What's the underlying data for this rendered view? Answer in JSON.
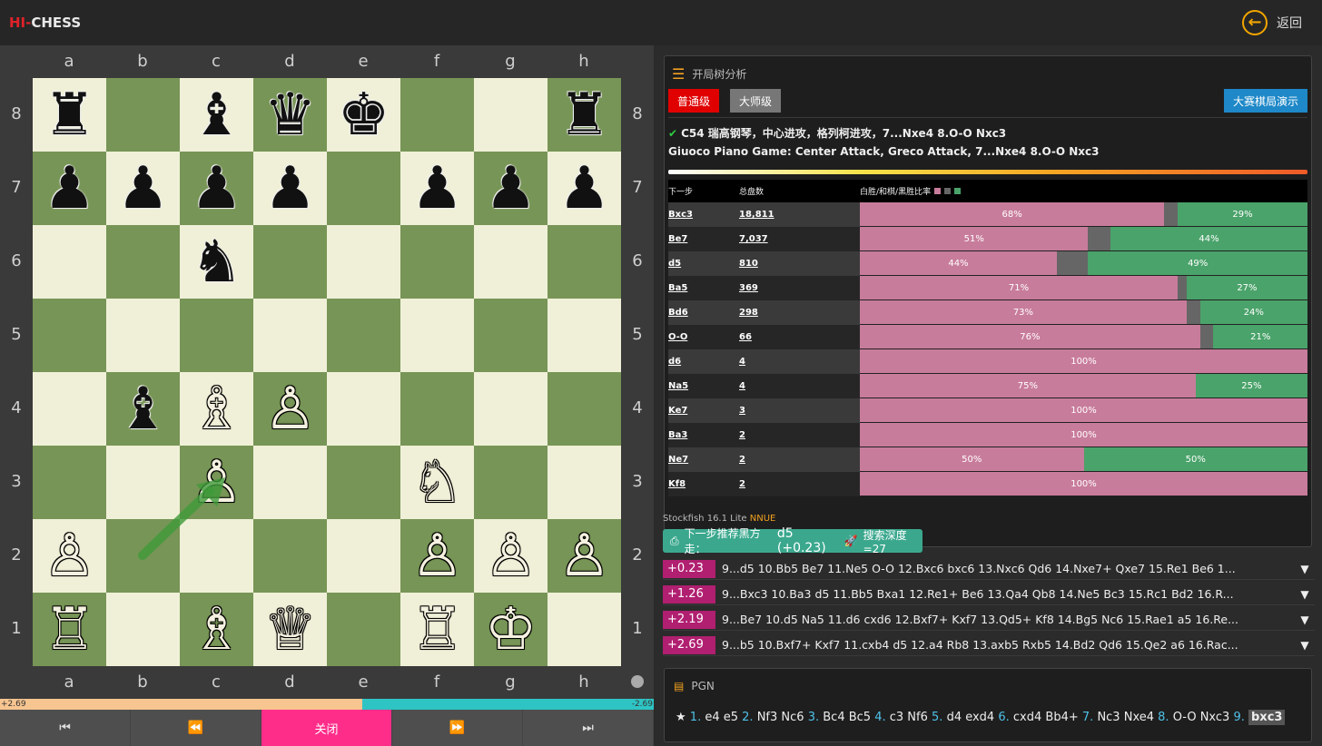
{
  "app": {
    "logo_hi": "HI-",
    "logo_chess": "CHESS",
    "back_label": "返回",
    "back_icon": "arrow-left-circle-icon"
  },
  "board": {
    "files": [
      "a",
      "b",
      "c",
      "d",
      "e",
      "f",
      "g",
      "h"
    ],
    "ranks": [
      "8",
      "7",
      "6",
      "5",
      "4",
      "3",
      "2",
      "1"
    ],
    "position": [
      [
        "♜",
        "",
        "♝",
        "♛",
        "♚",
        "",
        "",
        "♜"
      ],
      [
        "♟",
        "♟",
        "♟",
        "♟",
        "",
        "♟",
        "♟",
        "♟"
      ],
      [
        "",
        "",
        "♞",
        "",
        "",
        "",
        "",
        ""
      ],
      [
        "",
        "",
        "",
        "",
        "",
        "",
        "",
        ""
      ],
      [
        "",
        "♝",
        "♗",
        "♙",
        "",
        "",
        "",
        ""
      ],
      [
        "",
        "",
        "♙",
        "",
        "",
        "♘",
        "",
        ""
      ],
      [
        "♙",
        "",
        "",
        "",
        "",
        "♙",
        "♙",
        "♙"
      ],
      [
        "♖",
        "",
        "♗",
        "♕",
        "",
        "♖",
        "♔",
        ""
      ]
    ],
    "colors": [
      [
        "b",
        "",
        "b",
        "b",
        "b",
        "",
        "",
        "b"
      ],
      [
        "b",
        "b",
        "b",
        "b",
        "",
        "b",
        "b",
        "b"
      ],
      [
        "",
        "",
        "b",
        "",
        "",
        "",
        "",
        ""
      ],
      [
        "",
        "",
        "",
        "",
        "",
        "",
        "",
        ""
      ],
      [
        "",
        "b",
        "w",
        "w",
        "",
        "",
        "",
        ""
      ],
      [
        "",
        "",
        "w",
        "",
        "",
        "w",
        "",
        ""
      ],
      [
        "w",
        "",
        "",
        "",
        "",
        "w",
        "w",
        "w"
      ],
      [
        "w",
        "",
        "w",
        "w",
        "",
        "w",
        "w",
        ""
      ]
    ],
    "arrow": {
      "from": "b2",
      "to": "c3",
      "color": "#3f9a3a"
    }
  },
  "eval_bar": {
    "white_text": "+2.69",
    "black_text": "-2.69",
    "white_fraction": 0.554
  },
  "controls": [
    {
      "name": "first",
      "label": "⏮",
      "icon": "skip-back-icon"
    },
    {
      "name": "prev",
      "label": "⏪",
      "icon": "rewind-icon"
    },
    {
      "name": "close",
      "label": "关闭"
    },
    {
      "name": "next",
      "label": "⏩",
      "icon": "fast-forward-icon"
    },
    {
      "name": "last",
      "label": "⏭",
      "icon": "skip-forward-icon"
    }
  ],
  "opening": {
    "header": "开局树分析",
    "level_normal": "普通级",
    "level_master": "大师级",
    "demo_button": "大赛棋局演示",
    "name_cn": "C54 瑞高钢琴，中心进攻，格列柯进攻，7...Nxe4 8.O-O Nxc3",
    "name_en": "Giuoco Piano Game: Center Attack, Greco Attack, 7...Nxe4 8.O-O Nxc3",
    "col_move": "下一步",
    "col_count": "总盘数",
    "col_ratio": "白胜/和棋/黑胜比率",
    "colors": {
      "white": "#c87c9b",
      "draw": "#666666",
      "black": "#4aa36a"
    },
    "moves": [
      {
        "move": "Bxc3",
        "count": "18,811",
        "w": 68,
        "d": 3,
        "b": 29,
        "wl": "68%",
        "bl": "29%"
      },
      {
        "move": "Be7",
        "count": "7,037",
        "w": 51,
        "d": 5,
        "b": 44,
        "wl": "51%",
        "bl": "44%"
      },
      {
        "move": "d5",
        "count": "810",
        "w": 44,
        "d": 7,
        "b": 49,
        "wl": "44%",
        "bl": "49%"
      },
      {
        "move": "Ba5",
        "count": "369",
        "w": 71,
        "d": 2,
        "b": 27,
        "wl": "71%",
        "bl": "27%"
      },
      {
        "move": "Bd6",
        "count": "298",
        "w": 73,
        "d": 3,
        "b": 24,
        "wl": "73%",
        "bl": "24%"
      },
      {
        "move": "O-O",
        "count": "66",
        "w": 76,
        "d": 3,
        "b": 21,
        "wl": "76%",
        "bl": "21%"
      },
      {
        "move": "d6",
        "count": "4",
        "w": 100,
        "d": 0,
        "b": 0,
        "wl": "100%",
        "bl": ""
      },
      {
        "move": "Na5",
        "count": "4",
        "w": 75,
        "d": 0,
        "b": 25,
        "wl": "75%",
        "bl": "25%"
      },
      {
        "move": "Ke7",
        "count": "3",
        "w": 100,
        "d": 0,
        "b": 0,
        "wl": "100%",
        "bl": ""
      },
      {
        "move": "Ba3",
        "count": "2",
        "w": 100,
        "d": 0,
        "b": 0,
        "wl": "100%",
        "bl": ""
      },
      {
        "move": "Ne7",
        "count": "2",
        "w": 50,
        "d": 0,
        "b": 50,
        "wl": "50%",
        "bl": "50%"
      },
      {
        "move": "Kf8",
        "count": "2",
        "w": 100,
        "d": 0,
        "b": 0,
        "wl": "100%",
        "bl": ""
      }
    ]
  },
  "engine": {
    "name": "Stockfish 16.1 Lite",
    "nnue": "NNUE",
    "recommend_label": "下一步推荐黑方走：",
    "recommend_move": "d5 (+0.23)",
    "depth_label": "搜索深度=27",
    "lines": [
      {
        "eval": "+0.23",
        "moves": "9...d5 10.Bb5 Be7 11.Ne5 O-O 12.Bxc6 bxc6 13.Nxc6 Qd6 14.Nxe7+ Qxe7 15.Re1 Be6 1..."
      },
      {
        "eval": "+1.26",
        "moves": "9...Bxc3 10.Ba3 d5 11.Bb5 Bxa1 12.Re1+ Be6 13.Qa4 Qb8 14.Ne5 Bc3 15.Rc1 Bd2 16.R..."
      },
      {
        "eval": "+2.19",
        "moves": "9...Be7 10.d5 Na5 11.d6 cxd6 12.Bxf7+ Kxf7 13.Qd5+ Kf8 14.Bg5 Nc6 15.Rae1 a5 16.Re..."
      },
      {
        "eval": "+2.69",
        "moves": "9...b5 10.Bxf7+ Kxf7 11.cxb4 d5 12.a4 Rb8 13.axb5 Rxb5 14.Bd2 Qd6 15.Qe2 a6 16.Rac..."
      }
    ]
  },
  "pgn": {
    "header": "PGN",
    "star": "★",
    "moves": [
      {
        "n": "1.",
        "m": "e4 e5"
      },
      {
        "n": "2.",
        "m": "Nf3 Nc6"
      },
      {
        "n": "3.",
        "m": "Bc4 Bc5"
      },
      {
        "n": "4.",
        "m": "c3 Nf6"
      },
      {
        "n": "5.",
        "m": "d4 exd4"
      },
      {
        "n": "6.",
        "m": "cxd4 Bb4+"
      },
      {
        "n": "7.",
        "m": "Nc3 Nxe4"
      },
      {
        "n": "8.",
        "m": "O-O Nxc3"
      }
    ],
    "current_num": "9.",
    "current_move": "bxc3"
  }
}
